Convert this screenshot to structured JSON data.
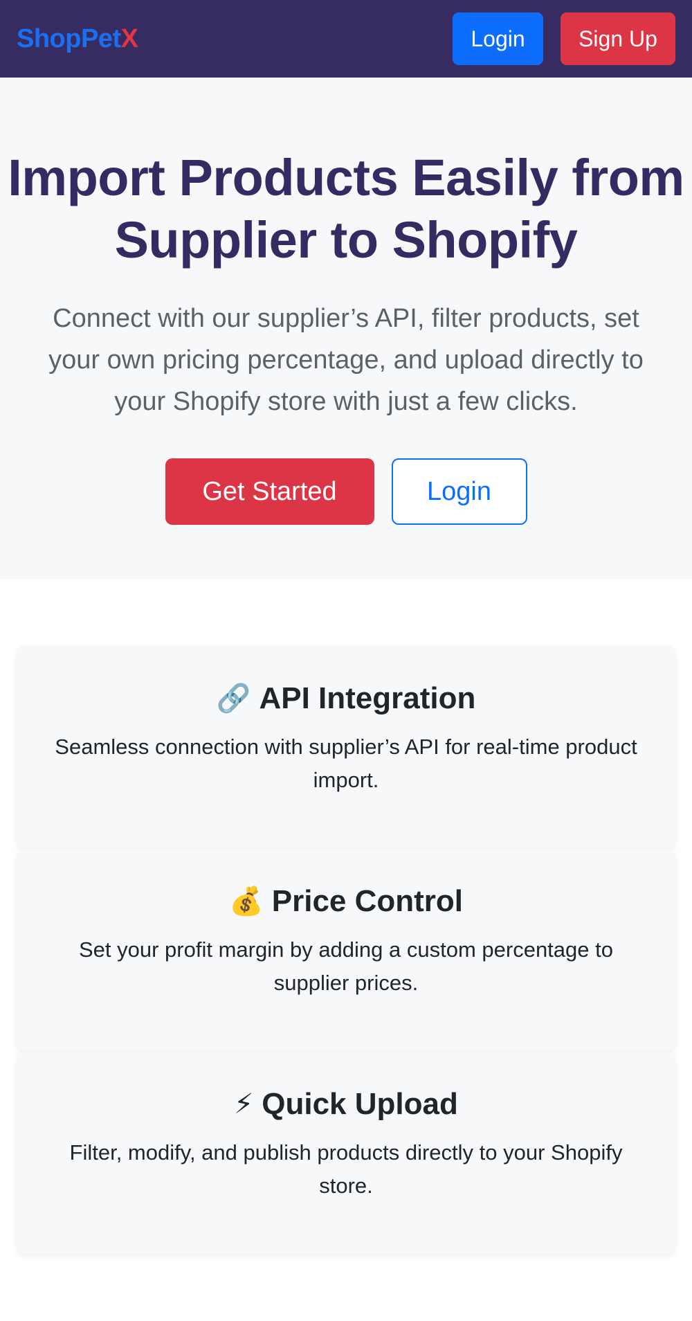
{
  "navbar": {
    "brand_part1": "ShopPet",
    "brand_part2": "X",
    "login_label": "Login",
    "signup_label": "Sign Up"
  },
  "hero": {
    "title": "Import Products Easily from Supplier to Shopify",
    "subtitle": "Connect with our supplier’s API, filter products, set your own pricing percentage, and upload directly to your Shopify store with just a few clicks.",
    "get_started_label": "Get Started",
    "login_label": "Login"
  },
  "features": [
    {
      "icon": "🔗",
      "icon_name": "link-icon",
      "title": "API Integration",
      "description": "Seamless connection with supplier’s API for real-time product import."
    },
    {
      "icon": "💰",
      "icon_name": "money-bag-icon",
      "title": "Price Control",
      "description": "Set your profit margin by adding a custom percentage to supplier prices."
    },
    {
      "icon": "⚡",
      "icon_name": "lightning-icon",
      "title": "Quick Upload",
      "description": "Filter, modify, and publish products directly to your Shopify store."
    }
  ],
  "colors": {
    "navbar_bg": "#362c62",
    "primary": "#0d6efd",
    "danger": "#dc3545",
    "hero_title": "#352b62"
  }
}
